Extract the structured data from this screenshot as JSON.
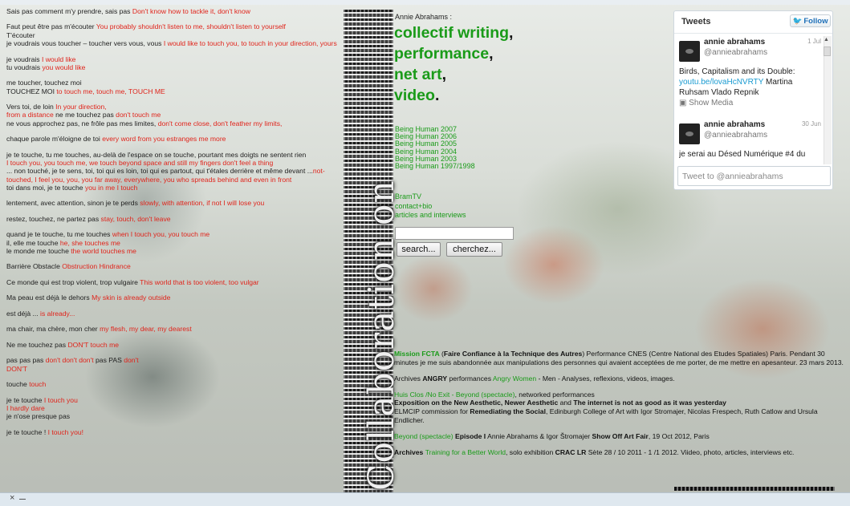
{
  "left_poem": [
    {
      "fr": "Sais pas comment m'y prendre, sais pas",
      "en": "Don't know how to tackle it, don't know"
    },
    {
      "fr": "Faut peut être pas m'écouter",
      "en": "You probably shouldn't listen to me, shouldn't listen to yourself",
      "fr2": "T'écouter"
    },
    {
      "fr": "je voudrais vous toucher – toucher vers vous, vous",
      "en": "I would like to touch you, to touch in your direction, yours"
    },
    {
      "fr": "je voudrais",
      "en": "I would like",
      "fr2": "tu voudrais",
      "en2": "you would like"
    },
    {
      "fr": "me toucher, touchez moi",
      "fr2": "TOUCHEZ MOI",
      "en2": "to touch me, touch me, TOUCH ME"
    },
    {
      "fr": "Vers toi, de loin",
      "en": "In your direction,",
      "en_line2": "from a distance",
      "fr3": "ne me touchez pas",
      "en3": "don't touch me",
      "fr4": "ne vous approchez pas, ne frôle pas mes limites,",
      "en4": "don't come close, don't feather my limits,"
    },
    {
      "fr": "chaque parole m'éloigne de toi",
      "en": "every word from you estranges me more"
    },
    {
      "fr": "je te touche, tu me touches, au-delà de l'espace on se touche, pourtant mes doigts ne sentent rien",
      "en": "I touch you, you touch me, we touch beyond space and still my fingers don't feel a thing",
      "fr2": "... non touché, je te sens, toi, toi qui es loin, toi qui es partout, qui t'étales derrière et même devant ...",
      "en2": "not-touched, I feel you, you, you far away, everywhere, you who spreads behind and even in front",
      "fr3": "toi dans moi, je te touche",
      "en3": "you in me I touch"
    },
    {
      "fr": "lentement, avec attention, sinon je te perds",
      "en": "slowly, with attention, if not I will lose you"
    },
    {
      "fr": "restez, touchez, ne partez pas",
      "en": "stay, touch, don't leave"
    },
    {
      "fr": "quand je te touche, tu me touches",
      "en": "when I touch you, you touch me",
      "fr2": "il, elle me touche",
      "en2": "he, she touches me",
      "fr3": "le monde me touche",
      "en3": "the world touches me"
    },
    {
      "fr": "Barrière Obstacle",
      "en": "Obstruction Hindrance"
    },
    {
      "fr": "Ce monde qui est trop violent, trop vulgaire",
      "en": "This world that is too violent, too vulgar"
    },
    {
      "fr": "Ma peau est déjà le dehors",
      "en": "My skin is already outside"
    },
    {
      "fr": "est déjà ...",
      "en": "is already..."
    },
    {
      "fr": "ma chair, ma chère, mon cher",
      "en": "my flesh, my dear, my dearest"
    },
    {
      "fr": "Ne me touchez pas",
      "en": "DON'T touch me"
    },
    {
      "fr": "pas pas pas",
      "en": "don't don't don't",
      "fr_mid": "pas PAS",
      "en_end": "don't",
      "en2": "DON'T"
    },
    {
      "fr": "touche",
      "en": "touch"
    },
    {
      "fr": "je te touche",
      "en": "I touch you",
      "en2": "I hardly dare",
      "fr3": "je n'ose presque pas"
    },
    {
      "fr": "je te touche !",
      "en": "I touch you!"
    }
  ],
  "strip": {
    "vertical_text": "Collaboration on"
  },
  "center": {
    "author": "Annie Abrahams :",
    "hero": [
      {
        "text": "collectif writing",
        "punct": ","
      },
      {
        "text": "performance",
        "punct": ","
      },
      {
        "text": "net art",
        "punct": ","
      },
      {
        "text": "video",
        "punct": "."
      }
    ],
    "years": [
      "Being Human 2007",
      "Being Human 2006",
      "Being Human 2005",
      "Being Human 2004",
      "Being Human 2003",
      "Being Human 1997/1998"
    ],
    "misc_links": [
      "BramTV",
      "contact+bio",
      "articles and interviews"
    ],
    "search": {
      "value": "",
      "search_label": "search...",
      "cherchez_label": "cherchez..."
    }
  },
  "projects": {
    "p1": {
      "g1": "Mission FCTA",
      "t1": " (",
      "b1": "Faire Confiance à la Technique des Autres",
      "t2": ") Performance CNES (Centre National des Etudes Spatiales) Paris. Pendant 30 minutes je me suis abandonnée aux manipulations des personnes qui avaient acceptées de me porter, de me mettre en apesanteur. 23 mars 2013."
    },
    "p2": {
      "t1": "Archives ",
      "b1": "ANGRY",
      "t2": " performances ",
      "g1": "Angry Women",
      "t3": " - Men - Analyses, reflexions, videos, images."
    },
    "p3": {
      "g1": "Huis Clos /No Exit - Beyond (spectacle)",
      "t1": ", networked performances",
      "b2": "Exposition on the New Aesthetic, Newer Aesthetic",
      "t2": " and ",
      "b3": "The internet is not as good as it was yesterday",
      "t3": "ELMCIP commission for ",
      "b4": "Remediating the Social",
      "t4": ", Edinburgh College of Art with Igor Stromajer, Nicolas Frespech, Ruth Catlow and Ursula Endlicher."
    },
    "p4": {
      "g1": "Beyond (spectacle)",
      "b1": " Episode I",
      "t1": " Annie Abrahams & Igor Štromajer ",
      "b2": "Show Off Art Fair",
      "t2": ", 19 Oct 2012, Paris"
    },
    "p5": {
      "b1": "Archives ",
      "g1": "Training for a Better World",
      "t1": ", solo exhibition ",
      "b2": "CRAC LR",
      "t2": " Sète 28 / 10 2011 -  1 /1 2012. Viideo, photo, articles, interviews etc."
    }
  },
  "tweets": {
    "title": "Tweets",
    "follow_label": "Follow",
    "items": [
      {
        "name": "annie abrahams",
        "handle": "@annieabrahams",
        "date": "1 Jul",
        "text": "Birds, Capitalism and its Double:",
        "link": "youtu.be/lovaHcNVRTY",
        "text2": " Martina Ruhsam Vlado Repnik",
        "media": "Show Media"
      },
      {
        "name": "annie abrahams",
        "handle": "@annieabrahams",
        "date": "30 Jun",
        "text": "je serai au Désed Numérique #4 du"
      }
    ],
    "compose_placeholder": "Tweet to @annieabrahams"
  },
  "bottombar": {
    "close": "×"
  },
  "colors": {
    "green": "#1a9b19",
    "red": "#e0241b",
    "twitter_blue": "#1d6fb8"
  }
}
